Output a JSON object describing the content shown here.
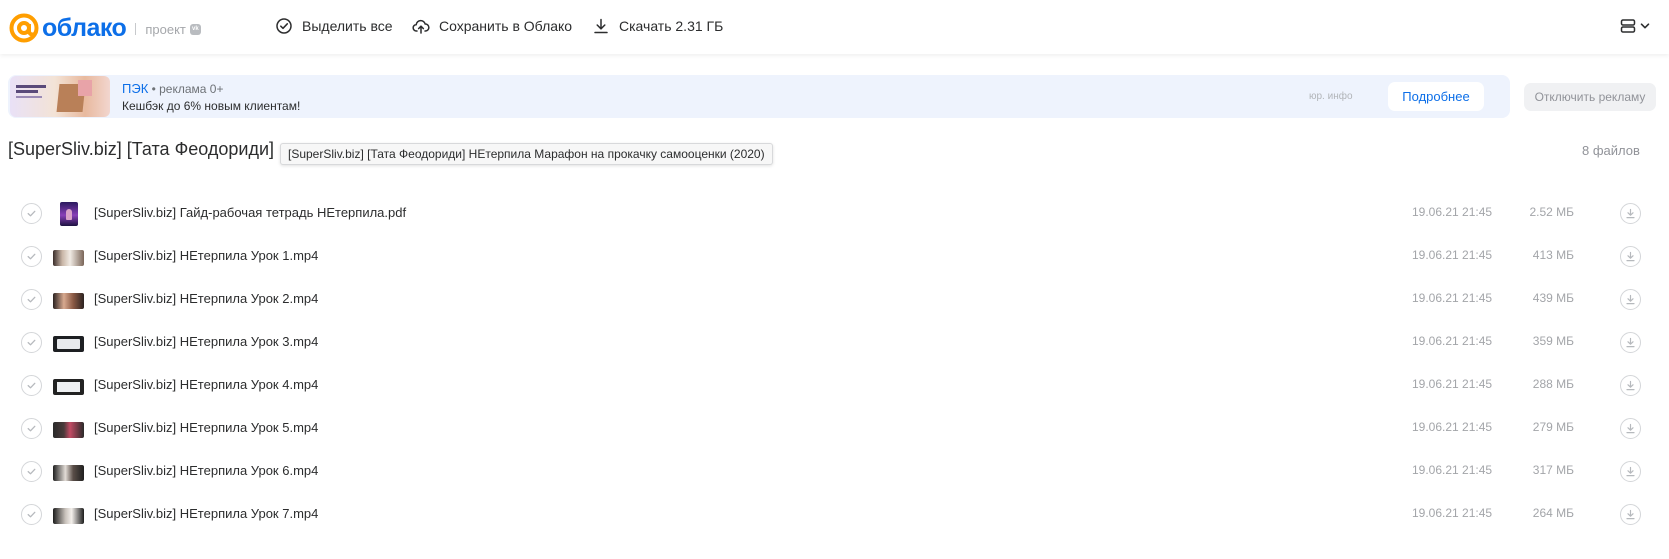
{
  "header": {
    "logo_text": "облако",
    "project_label": "проект",
    "vk_badge": "vk",
    "select_all": "Выделить все",
    "save_to_cloud": "Сохранить в Облако",
    "download": "Скачать 2.31 ГБ"
  },
  "ad": {
    "brand": "ПЭК",
    "meta": " • реклама 0+",
    "description": "Кешбэк до 6% новым клиентам!",
    "legal": "юр. инфо",
    "more_button": "Подробнее",
    "disable_button": "Отключить рекламу"
  },
  "folder": {
    "title": "[SuperSliv.biz] [Тата Феодориди]",
    "tooltip": "[SuperSliv.biz] [Тата Феодориди] НЕтерпила Марафон на прокачку самооценки (2020)",
    "file_count": "8 файлов"
  },
  "files": [
    {
      "name": "[SuperSliv.biz] Гайд-рабочая тетрадь НЕтерпила.pdf",
      "date": "19.06.21 21:45",
      "size": "2.52 МБ"
    },
    {
      "name": "[SuperSliv.biz] НЕтерпила Урок 1.mp4",
      "date": "19.06.21 21:45",
      "size": "413 МБ"
    },
    {
      "name": "[SuperSliv.biz] НЕтерпила Урок 2.mp4",
      "date": "19.06.21 21:45",
      "size": "439 МБ"
    },
    {
      "name": "[SuperSliv.biz] НЕтерпила Урок 3.mp4",
      "date": "19.06.21 21:45",
      "size": "359 МБ"
    },
    {
      "name": "[SuperSliv.biz] НЕтерпила Урок 4.mp4",
      "date": "19.06.21 21:45",
      "size": "288 МБ"
    },
    {
      "name": "[SuperSliv.biz] НЕтерпила Урок 5.mp4",
      "date": "19.06.21 21:45",
      "size": "279 МБ"
    },
    {
      "name": "[SuperSliv.biz] НЕтерпила Урок 6.mp4",
      "date": "19.06.21 21:45",
      "size": "317 МБ"
    },
    {
      "name": "[SuperSliv.biz] НЕтерпила Урок 7.mp4",
      "date": "19.06.21 21:45",
      "size": "264 МБ"
    }
  ],
  "colors": {
    "brand_blue": "#0d6fe8",
    "logo_orange": "#ff9e00",
    "ad_background": "#eef3fd"
  },
  "icons": [
    "at-logo-icon",
    "check-circle-icon",
    "cloud-upload-icon",
    "download-icon",
    "view-toggle-icon",
    "chevron-down-icon"
  ]
}
